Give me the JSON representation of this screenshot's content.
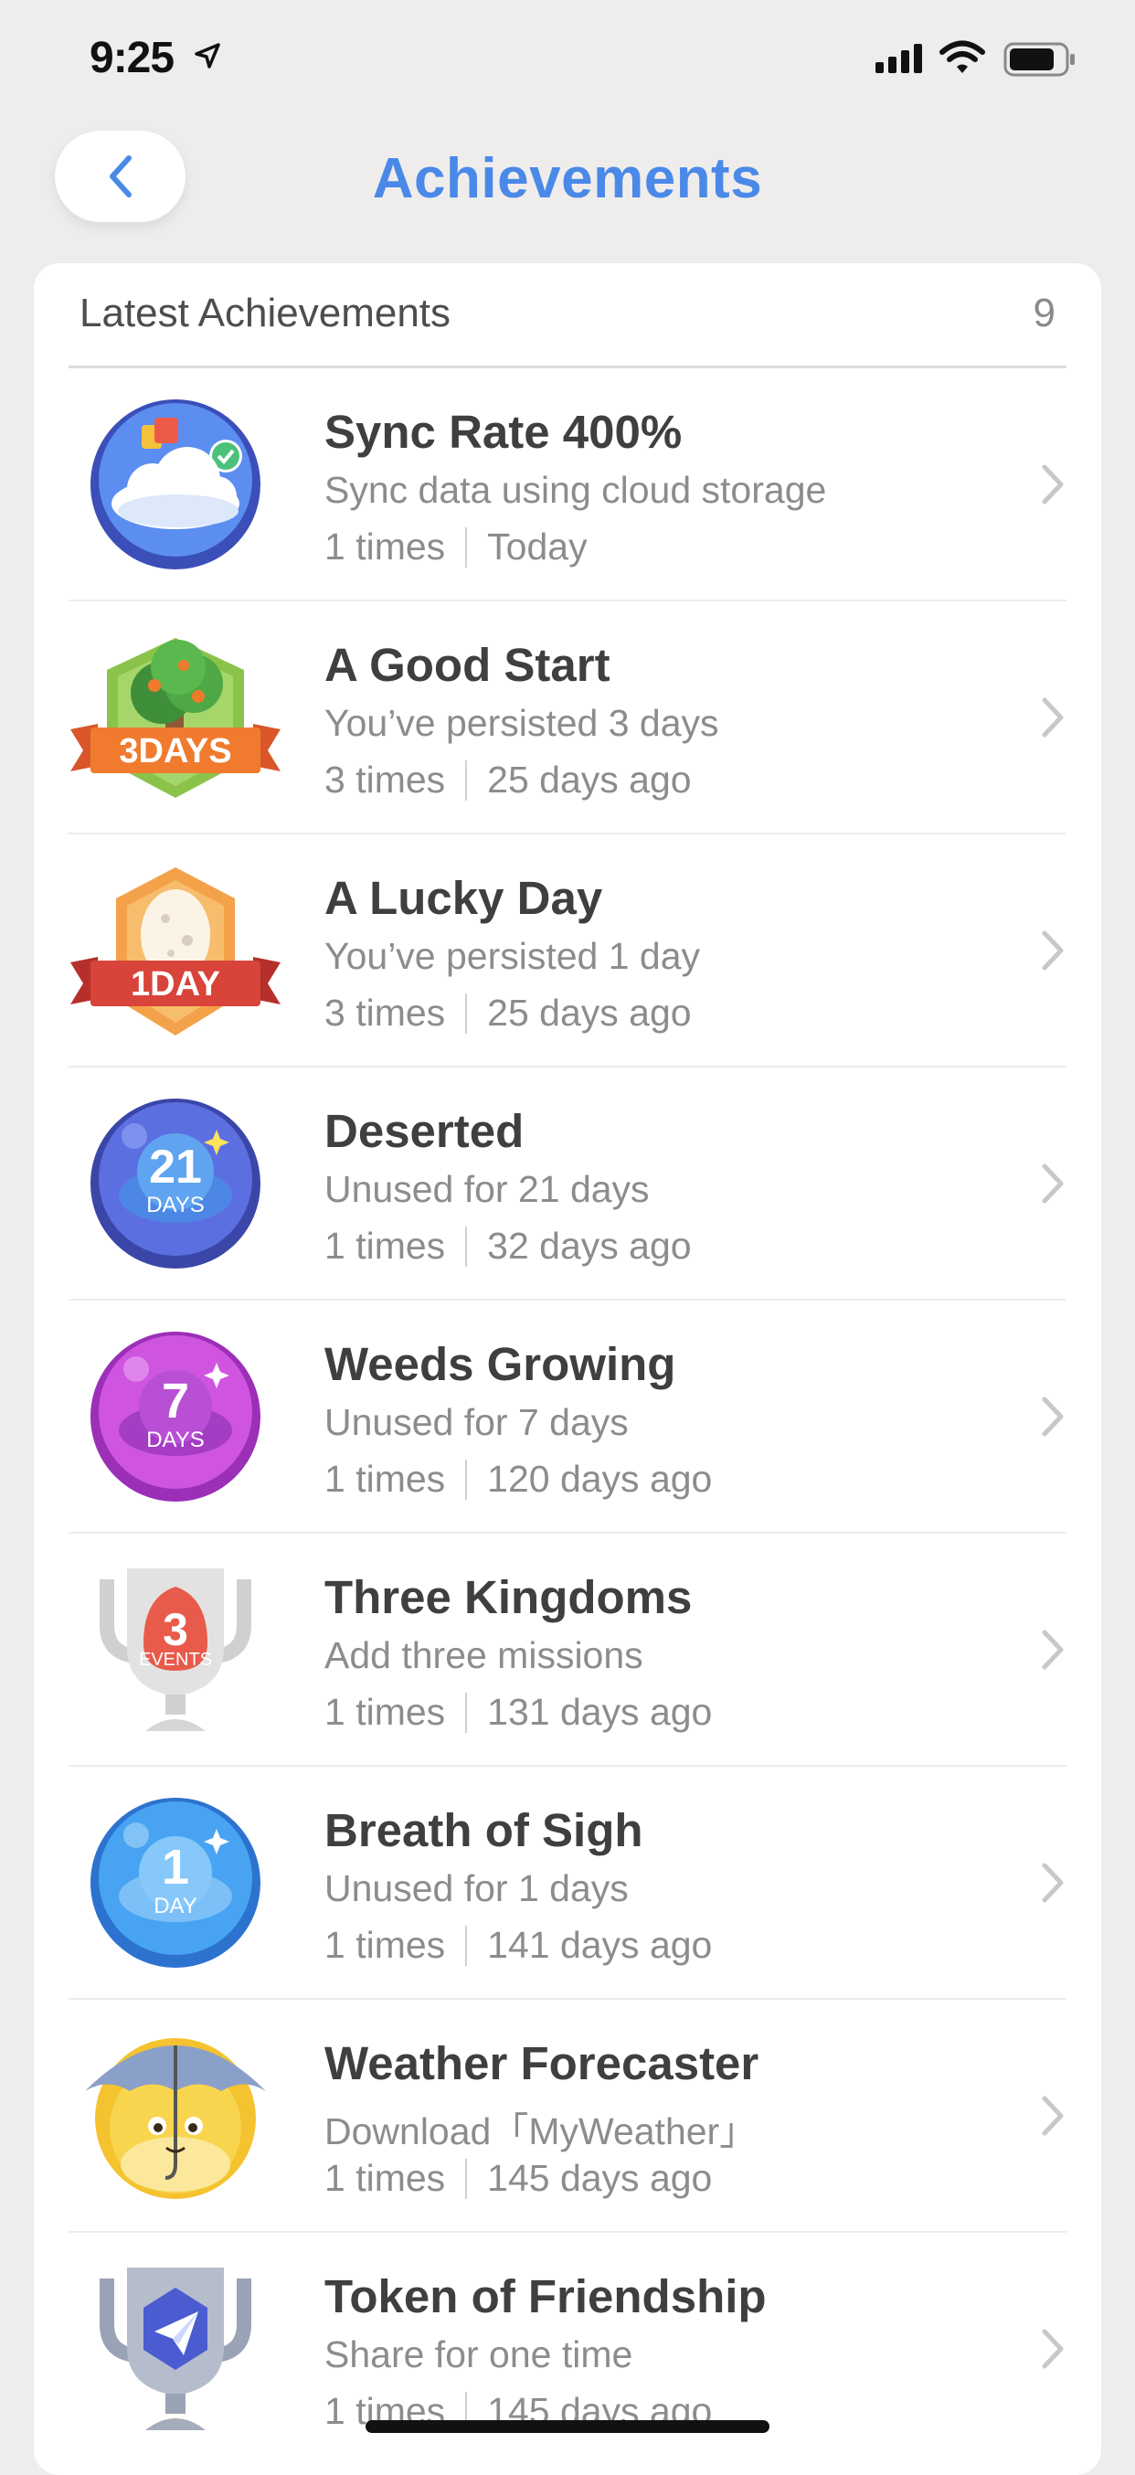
{
  "status": {
    "time": "9:25"
  },
  "nav": {
    "title": "Achievements"
  },
  "section": {
    "label": "Latest Achievements",
    "count": "9"
  },
  "achievements": [
    {
      "name": "Sync Rate 400%",
      "desc": "Sync data using cloud storage",
      "times": "1 times",
      "when": "Today",
      "badge": "cloud-sync-badge-icon"
    },
    {
      "name": "A Good Start",
      "desc": "You’ve persisted 3 days",
      "times": "3 times",
      "when": "25 days ago",
      "badge": "tree-3-days-badge-icon",
      "badge_text": "3DAYS"
    },
    {
      "name": "A Lucky Day",
      "desc": "You’ve persisted 1 day",
      "times": "3 times",
      "when": "25 days ago",
      "badge": "egg-1-day-badge-icon",
      "badge_text": "1DAY"
    },
    {
      "name": "Deserted",
      "desc": "Unused for 21 days",
      "times": "1 times",
      "when": "32 days ago",
      "badge": "21-days-badge-icon",
      "badge_num": "21",
      "badge_unit": "DAYS"
    },
    {
      "name": "Weeds Growing",
      "desc": "Unused for 7 days",
      "times": "1 times",
      "when": "120 days ago",
      "badge": "7-days-badge-icon",
      "badge_num": "7",
      "badge_unit": "DAYS"
    },
    {
      "name": "Three Kingdoms",
      "desc": "Add three missions",
      "times": "1 times",
      "when": "131 days ago",
      "badge": "trophy-3-events-badge-icon",
      "badge_num": "3",
      "badge_unit": "EVENTS"
    },
    {
      "name": "Breath of Sigh",
      "desc": "Unused for 1 days",
      "times": "1 times",
      "when": "141 days ago",
      "badge": "1-day-badge-icon",
      "badge_num": "1",
      "badge_unit": "DAY"
    },
    {
      "name": "Weather Forecaster",
      "desc": "Download「MyWeather」",
      "times": "1 times",
      "when": "145 days ago",
      "badge": "umbrella-weather-badge-icon"
    },
    {
      "name": "Token of Friendship",
      "desc": "Share for one time",
      "times": "1 times",
      "when": "145 days ago",
      "badge": "trophy-paper-plane-badge-icon"
    }
  ]
}
